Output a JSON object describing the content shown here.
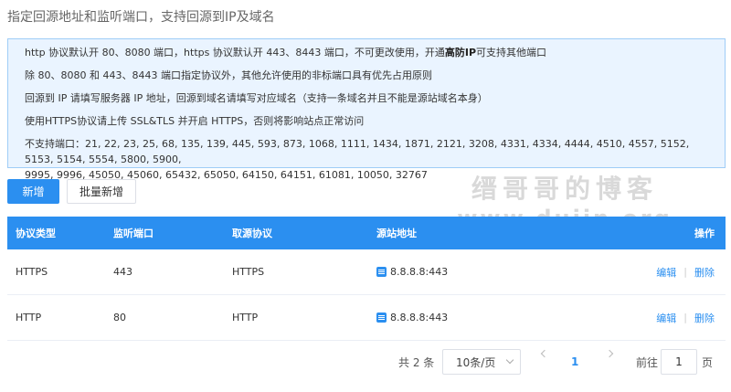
{
  "page": {
    "title": "指定回源地址和监听端口，支持回源到IP及域名"
  },
  "notice": {
    "line1_a": "http 协议默认开 80、8080 端口，https 协议默认开 443、8443 端口，不可更改使用，开通",
    "line1_bold": "高防IP",
    "line1_b": "可支持其他端口",
    "line2": "除 80、8080 和 443、8443 端口指定协议外，其他允许使用的非标端口具有优先占用原则",
    "line3": "回源到 IP 请填写服务器 IP 地址，回源到域名请填写对应域名（支持一条域名并且不能是源站域名本身）",
    "line4": "使用HTTPS协议请上传 SSL&TLS 并开启 HTTPS，否则将影响站点正常访问",
    "line5": "不支持端口：21, 22, 23, 25, 68, 135, 139, 445, 593, 873, 1068, 1111, 1434, 1871, 2121, 3208, 4331, 4334, 4444, 4510, 4557, 5152, 5153, 5154, 5554, 5800, 5900,",
    "line6": "9995, 9996, 45050, 45060, 65432, 65050, 64150, 64151, 61081, 10050, 32767"
  },
  "toolbar": {
    "add_label": "新增",
    "batch_add_label": "批量新增"
  },
  "watermark": {
    "line1": "缙哥哥的博客",
    "line2": "www.dujin.org"
  },
  "table": {
    "headers": {
      "protocol": "协议类型",
      "port": "监听端口",
      "origin_protocol": "取源协议",
      "origin_address": "源站地址",
      "actions": "操作"
    },
    "rows": [
      {
        "protocol": "HTTPS",
        "port": "443",
        "origin_protocol": "HTTPS",
        "origin_address": "8.8.8.8:443",
        "edit": "编辑",
        "delete": "删除"
      },
      {
        "protocol": "HTTP",
        "port": "80",
        "origin_protocol": "HTTP",
        "origin_address": "8.8.8.8:443",
        "edit": "编辑",
        "delete": "删除"
      }
    ]
  },
  "pagination": {
    "total": "共 2 条",
    "page_size": "10条/页",
    "current_page": "1",
    "goto_prefix": "前往",
    "goto_value": "1",
    "goto_suffix": "页"
  },
  "colors": {
    "primary": "#2b8ff0",
    "notice_bg": "#eaf4ff",
    "notice_border": "#9fcdf7"
  }
}
